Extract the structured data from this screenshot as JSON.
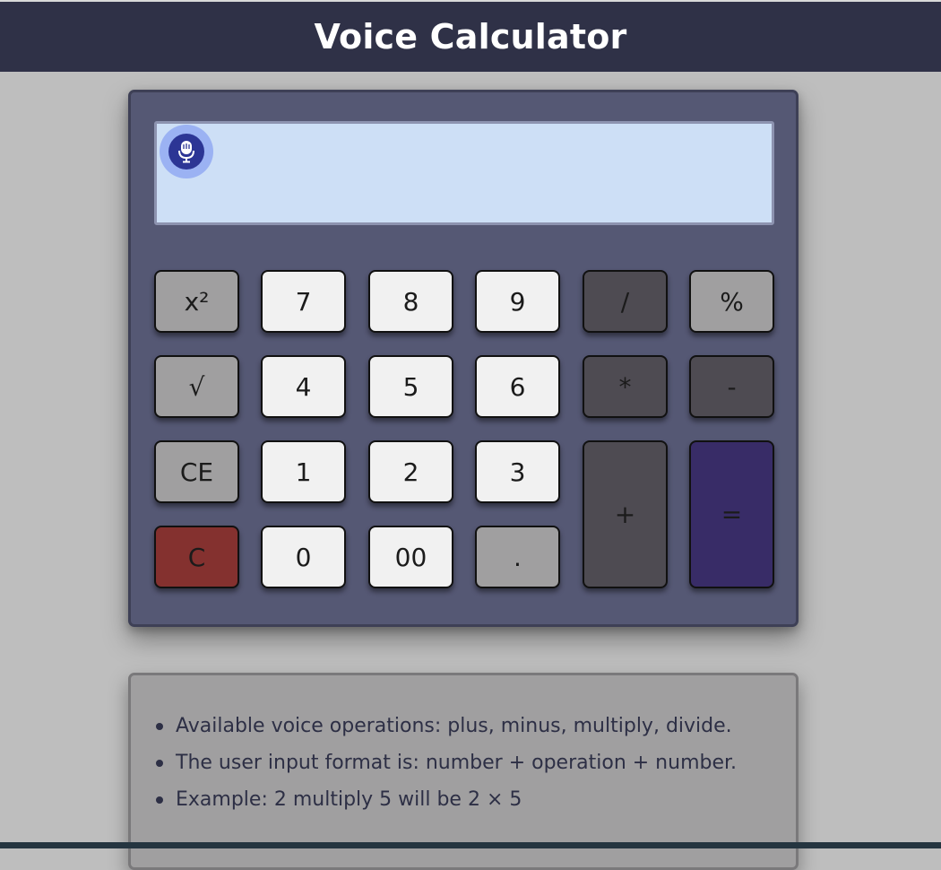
{
  "header": {
    "title": "Voice Calculator"
  },
  "display": {
    "value": ""
  },
  "mic": {
    "icon": "microphone-icon"
  },
  "keys": {
    "square": "x²",
    "seven": "7",
    "eight": "8",
    "nine": "9",
    "divide": "/",
    "percent": "%",
    "sqrt": "√",
    "four": "4",
    "five": "5",
    "six": "6",
    "multiply": "*",
    "minus": "-",
    "clear_entry": "CE",
    "one": "1",
    "two": "2",
    "three": "3",
    "plus": "+",
    "equals": "=",
    "clear": "C",
    "zero": "0",
    "double_zero": "00",
    "decimal": "."
  },
  "info": {
    "items": [
      "Available voice operations: plus, minus, multiply, divide.",
      "The user input format is: number + operation + number.",
      "Example: 2 multiply 5 will be 2 × 5"
    ]
  },
  "colors": {
    "header_bg": "#2f3147",
    "calculator_bg": "#555874",
    "display_bg": "#cddff6",
    "mic_outer": "#9bb2f3",
    "mic_inner": "#2c3595",
    "key_light": "#f1f1f1",
    "key_gray": "#a09fa0",
    "key_dark": "#4e4b52",
    "key_clear": "#84312f",
    "key_equals": "#382c67"
  }
}
